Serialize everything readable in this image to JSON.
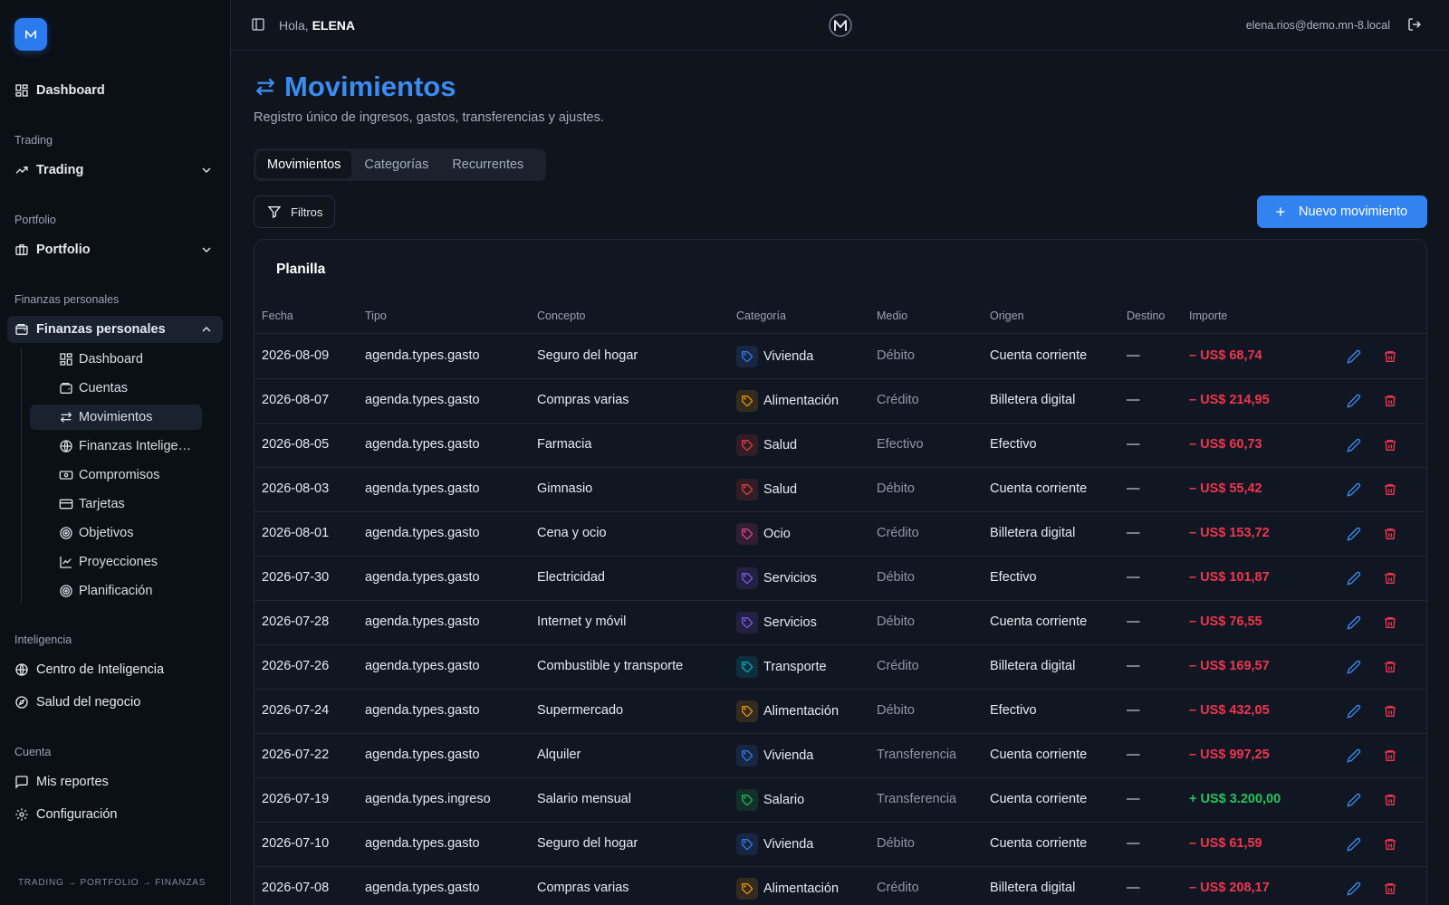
{
  "topbar": {
    "greeting": "Hola,",
    "user_name": "ELENA",
    "email": "elena.rios@demo.mn-8.local"
  },
  "sidebar": {
    "main_item": "Dashboard",
    "sections": {
      "trading": "Trading",
      "portfolio": "Portfolio",
      "finanzas": "Finanzas personales",
      "inteligencia": "Inteligencia",
      "cuenta": "Cuenta"
    },
    "trading_item": "Trading",
    "portfolio_item": "Portfolio",
    "finanzas_item": "Finanzas personales",
    "finanzas_sub": [
      {
        "label": "Dashboard",
        "icon": "dashboard-icon"
      },
      {
        "label": "Cuentas",
        "icon": "wallet-icon"
      },
      {
        "label": "Movimientos",
        "icon": "arrows-icon"
      },
      {
        "label": "Finanzas Inteligentes",
        "icon": "globe-icon"
      },
      {
        "label": "Compromisos",
        "icon": "banknote-icon"
      },
      {
        "label": "Tarjetas",
        "icon": "credit-card-icon"
      },
      {
        "label": "Objetivos",
        "icon": "target-icon"
      },
      {
        "label": "Proyecciones",
        "icon": "line-chart-icon"
      },
      {
        "label": "Planificación",
        "icon": "target-icon"
      }
    ],
    "inteligencia_items": [
      "Centro de Inteligencia",
      "Salud del negocio"
    ],
    "cuenta_items": [
      "Mis reportes",
      "Configuración"
    ],
    "footer_trail": "TRADING → PORTFOLIO → FINANZAS"
  },
  "page": {
    "title": "Movimientos",
    "subtitle": "Registro único de ingresos, gastos, transferencias y ajustes.",
    "tabs": [
      "Movimientos",
      "Categorías",
      "Recurrentes"
    ],
    "filters_label": "Filtros",
    "new_button": "Nuevo movimiento"
  },
  "table": {
    "title": "Planilla",
    "columns": [
      "Fecha",
      "Tipo",
      "Concepto",
      "Categoría",
      "Medio",
      "Origen",
      "Destino",
      "Importe"
    ],
    "rows": [
      {
        "fecha": "2026-08-09",
        "tipo": "agenda.types.gasto",
        "concepto": "Seguro del hogar",
        "categoria": "Vivienda",
        "cat_color": "#3b82f6",
        "medio": "Débito",
        "origen": "Cuenta corriente",
        "destino": "—",
        "importe": "– US$ 68,74",
        "sign": "neg"
      },
      {
        "fecha": "2026-08-07",
        "tipo": "agenda.types.gasto",
        "concepto": "Compras varias",
        "categoria": "Alimentación",
        "cat_color": "#f59e0b",
        "medio": "Crédito",
        "origen": "Billetera digital",
        "destino": "—",
        "importe": "– US$ 214,95",
        "sign": "neg"
      },
      {
        "fecha": "2026-08-05",
        "tipo": "agenda.types.gasto",
        "concepto": "Farmacia",
        "categoria": "Salud",
        "cat_color": "#ef4444",
        "medio": "Efectivo",
        "origen": "Efectivo",
        "destino": "—",
        "importe": "– US$ 60,73",
        "sign": "neg"
      },
      {
        "fecha": "2026-08-03",
        "tipo": "agenda.types.gasto",
        "concepto": "Gimnasio",
        "categoria": "Salud",
        "cat_color": "#ef4444",
        "medio": "Débito",
        "origen": "Cuenta corriente",
        "destino": "—",
        "importe": "– US$ 55,42",
        "sign": "neg"
      },
      {
        "fecha": "2026-08-01",
        "tipo": "agenda.types.gasto",
        "concepto": "Cena y ocio",
        "categoria": "Ocio",
        "cat_color": "#ec4899",
        "medio": "Crédito",
        "origen": "Billetera digital",
        "destino": "—",
        "importe": "– US$ 153,72",
        "sign": "neg"
      },
      {
        "fecha": "2026-07-30",
        "tipo": "agenda.types.gasto",
        "concepto": "Electricidad",
        "categoria": "Servicios",
        "cat_color": "#8b5cf6",
        "medio": "Débito",
        "origen": "Efectivo",
        "destino": "—",
        "importe": "– US$ 101,87",
        "sign": "neg"
      },
      {
        "fecha": "2026-07-28",
        "tipo": "agenda.types.gasto",
        "concepto": "Internet y móvil",
        "categoria": "Servicios",
        "cat_color": "#8b5cf6",
        "medio": "Débito",
        "origen": "Cuenta corriente",
        "destino": "—",
        "importe": "– US$ 76,55",
        "sign": "neg"
      },
      {
        "fecha": "2026-07-26",
        "tipo": "agenda.types.gasto",
        "concepto": "Combustible y transporte",
        "categoria": "Transporte",
        "cat_color": "#06b6d4",
        "medio": "Crédito",
        "origen": "Billetera digital",
        "destino": "—",
        "importe": "– US$ 169,57",
        "sign": "neg"
      },
      {
        "fecha": "2026-07-24",
        "tipo": "agenda.types.gasto",
        "concepto": "Supermercado",
        "categoria": "Alimentación",
        "cat_color": "#f59e0b",
        "medio": "Débito",
        "origen": "Efectivo",
        "destino": "—",
        "importe": "– US$ 432,05",
        "sign": "neg"
      },
      {
        "fecha": "2026-07-22",
        "tipo": "agenda.types.gasto",
        "concepto": "Alquiler",
        "categoria": "Vivienda",
        "cat_color": "#3b82f6",
        "medio": "Transferencia",
        "origen": "Cuenta corriente",
        "destino": "—",
        "importe": "– US$ 997,25",
        "sign": "neg"
      },
      {
        "fecha": "2026-07-19",
        "tipo": "agenda.types.ingreso",
        "concepto": "Salario mensual",
        "categoria": "Salario",
        "cat_color": "#22c55e",
        "medio": "Transferencia",
        "origen": "Cuenta corriente",
        "destino": "—",
        "importe": "+ US$ 3.200,00",
        "sign": "pos"
      },
      {
        "fecha": "2026-07-10",
        "tipo": "agenda.types.gasto",
        "concepto": "Seguro del hogar",
        "categoria": "Vivienda",
        "cat_color": "#3b82f6",
        "medio": "Débito",
        "origen": "Cuenta corriente",
        "destino": "—",
        "importe": "– US$ 61,59",
        "sign": "neg"
      },
      {
        "fecha": "2026-07-08",
        "tipo": "agenda.types.gasto",
        "concepto": "Compras varias",
        "categoria": "Alimentación",
        "cat_color": "#f59e0b",
        "medio": "Crédito",
        "origen": "Billetera digital",
        "destino": "—",
        "importe": "– US$ 208,17",
        "sign": "neg"
      }
    ]
  },
  "colors": {
    "accent": "#3283f0",
    "negative": "#ef3550",
    "positive": "#22c55e"
  }
}
